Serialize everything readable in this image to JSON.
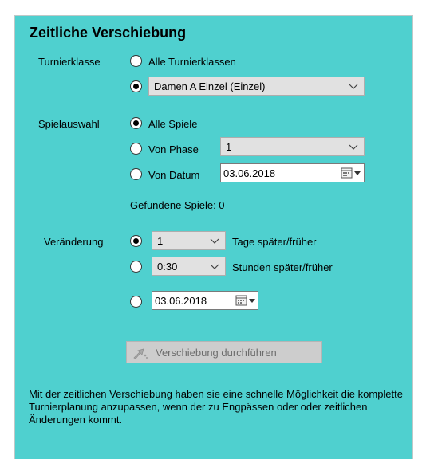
{
  "title": "Zeitliche Verschiebung",
  "turnierklasse": {
    "label": "Turnierklasse",
    "option_all": "Alle Turnierklassen",
    "selected_value": "Damen A Einzel (Einzel)",
    "selected_option": 2
  },
  "spielauswahl": {
    "label": "Spielauswahl",
    "option_all": "Alle Spiele",
    "option_phase": "Von Phase",
    "phase_value": "1",
    "option_datum": "Von Datum",
    "datum_value": "03.06.2018",
    "selected_option": 1
  },
  "found_games": "Gefundene Spiele: 0",
  "veraenderung": {
    "label": "Veränderung",
    "days_value": "1",
    "days_label": "Tage später/früher",
    "hours_value": "0:30",
    "hours_label": "Stunden später/früher",
    "date_value": "03.06.2018",
    "selected_option": 1
  },
  "execute_button": "Verschiebung durchführen",
  "info_text": "Mit der zeitlichen Verschiebung haben sie eine schnelle Möglichkeit die komplette Turnierplanung anzupassen, wenn der zu Engpässen oder oder zeitlichen Änderungen kommt.",
  "icons": {
    "dropdown": "chevron-down-icon",
    "calendar": "calendar-icon",
    "execute": "shift-arrow-icon"
  },
  "colors": {
    "panel_background": "#4fd0cf",
    "combo_background": "#e1e1e1",
    "button_disabled": "#cdcdcd"
  }
}
